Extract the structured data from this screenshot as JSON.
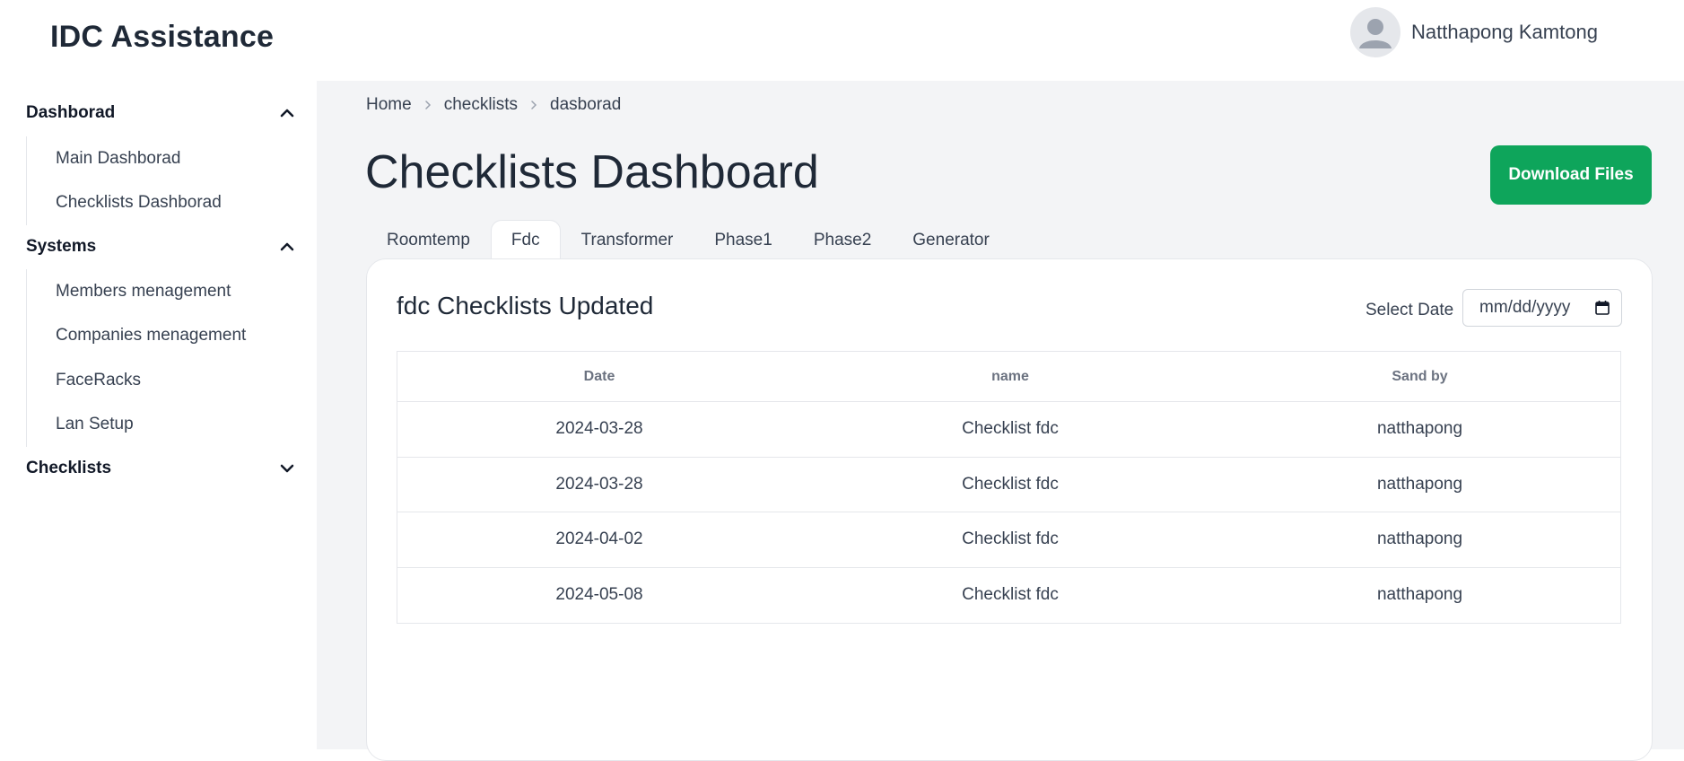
{
  "app": {
    "title": "IDC Assistance"
  },
  "user": {
    "name": "Natthapong Kamtong"
  },
  "sidebar": {
    "sections": [
      {
        "title": "Dashborad",
        "expanded": true,
        "items": [
          "Main Dashborad",
          "Checklists Dashborad"
        ]
      },
      {
        "title": "Systems",
        "expanded": true,
        "items": [
          "Members menagement",
          "Companies menagement",
          "FaceRacks",
          "Lan Setup"
        ]
      },
      {
        "title": "Checklists",
        "expanded": false,
        "items": []
      }
    ]
  },
  "breadcrumb": [
    "Home",
    "checklists",
    "dasborad"
  ],
  "page": {
    "title": "Checklists Dashboard",
    "download_label": "Download Files"
  },
  "tabs": [
    "Roomtemp",
    "Fdc",
    "Transformer",
    "Phase1",
    "Phase2",
    "Generator"
  ],
  "active_tab": "Fdc",
  "panel": {
    "title": "fdc Checklists Updated",
    "date_label": "Select Date",
    "date_placeholder": "mm/dd/yyyy"
  },
  "table": {
    "headers": [
      "Date",
      "name",
      "Sand by"
    ],
    "rows": [
      [
        "2024-03-28",
        "Checklist fdc",
        "natthapong"
      ],
      [
        "2024-03-28",
        "Checklist fdc",
        "natthapong"
      ],
      [
        "2024-04-02",
        "Checklist fdc",
        "natthapong"
      ],
      [
        "2024-05-08",
        "Checklist fdc",
        "natthapong"
      ]
    ]
  },
  "colors": {
    "accent": "#0ea55b",
    "main_bg": "#f3f4f6"
  },
  "icons": [
    "user-avatar-icon",
    "chevron-up-icon",
    "chevron-down-icon",
    "chevron-right-icon",
    "calendar-icon"
  ]
}
